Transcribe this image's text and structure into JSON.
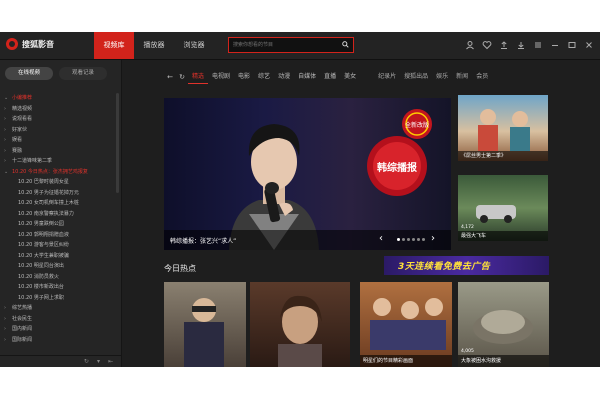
{
  "app": {
    "name": "搜狐影音",
    "top_tabs": [
      "视频库",
      "播放器",
      "浏览器"
    ],
    "active_tab": 0
  },
  "search": {
    "placeholder": "搜索你想看的节目"
  },
  "sidebar": {
    "tabs": [
      "在线视频",
      "观看记录"
    ],
    "items": [
      {
        "label": "小编推荐",
        "type": "header-open"
      },
      {
        "label": "精选视频",
        "type": "item"
      },
      {
        "label": "说观看看",
        "type": "item"
      },
      {
        "label": "好家伙",
        "type": "item"
      },
      {
        "label": "娱看",
        "type": "item"
      },
      {
        "label": "赛融",
        "type": "item"
      },
      {
        "label": "十二道锋味第二季",
        "type": "item"
      },
      {
        "label": "10.20 今日热点：张杰拥艺鸡报复",
        "type": "header-hl"
      },
      {
        "label": "10.20 巴黎时装周女星",
        "type": "sub"
      },
      {
        "label": "10.20 男子为征婚花掉万元",
        "type": "sub"
      },
      {
        "label": "10.20 女司机倒车撞上木桩",
        "type": "sub"
      },
      {
        "label": "10.20 南京警察执法暴力",
        "type": "sub"
      },
      {
        "label": "10.20 男童跌倒公园",
        "type": "sub"
      },
      {
        "label": "10.20 郭明翔捐赠血液",
        "type": "sub"
      },
      {
        "label": "10.20 游客与景区纠纷",
        "type": "sub"
      },
      {
        "label": "10.20 大学生兼职被骗",
        "type": "sub"
      },
      {
        "label": "10.20 明星同台演出",
        "type": "sub"
      },
      {
        "label": "10.20 消防员救火",
        "type": "sub"
      },
      {
        "label": "10.20 楼市新政出台",
        "type": "sub"
      },
      {
        "label": "10.20 男子网上求职",
        "type": "sub"
      },
      {
        "label": "综艺热播",
        "type": "item"
      },
      {
        "label": "社会民生",
        "type": "item"
      },
      {
        "label": "国内新闻",
        "type": "item"
      },
      {
        "label": "国际新闻",
        "type": "item"
      }
    ]
  },
  "categories": [
    "精选",
    "电视剧",
    "电影",
    "综艺",
    "动漫",
    "自媒体",
    "直播",
    "美女",
    "纪录片",
    "搜狐出品",
    "娱乐",
    "新闻",
    "会员"
  ],
  "active_category": 0,
  "banner": {
    "caption": "韩综播报：张艺兴“求人”",
    "show_logo_text": "韩综播报",
    "badge_text": "全新改版"
  },
  "side_thumbs": [
    {
      "label": "《屌丝男士第二季》",
      "count": ""
    },
    {
      "label": "最强大飞车",
      "count": "4,172"
    }
  ],
  "section": {
    "title": "今日热点"
  },
  "ad": {
    "text": "3天连续看免费去广告"
  },
  "tiles": [
    {
      "label": "",
      "count": ""
    },
    {
      "label": "",
      "count": ""
    },
    {
      "label": "明星们的节目精彩画面",
      "count": ""
    },
    {
      "label": "大象被困水沟救援",
      "count": "4,005"
    }
  ],
  "colors": {
    "accent": "#d2231b",
    "bg": "#1e1e1e",
    "ad_text": "#ffe23a"
  }
}
